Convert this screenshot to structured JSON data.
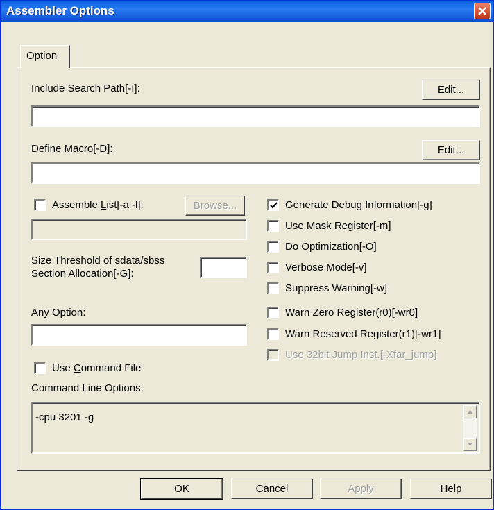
{
  "window": {
    "title": "Assembler Options"
  },
  "tabs": [
    {
      "label": "Option"
    }
  ],
  "include_path": {
    "label": "Include Search Path[-I]:",
    "edit_label": "Edit...",
    "value": ""
  },
  "define_macro": {
    "label_pre": "Define ",
    "label_u": "M",
    "label_post": "acro[-D]:",
    "edit_label": "Edit...",
    "value": ""
  },
  "assemble_list": {
    "label_pre": "Assemble ",
    "label_u": "L",
    "label_post": "ist[-a -l]:",
    "checked": false,
    "browse_label": "Browse...",
    "value": ""
  },
  "size_threshold": {
    "label_line1": "Size Threshold of sdata/sbss",
    "label_line2": "Section Allocation[-G]:",
    "value": ""
  },
  "any_option": {
    "label": "Any Option:",
    "value": ""
  },
  "use_command_file": {
    "label_pre": "Use ",
    "label_u": "C",
    "label_post": "ommand File",
    "checked": false
  },
  "command_line": {
    "label": "Command Line Options:",
    "value": "-cpu 3201 -g"
  },
  "options": [
    {
      "label": "Generate Debug Information[-g]",
      "checked": true,
      "enabled": true
    },
    {
      "label": "Use Mask Register[-m]",
      "checked": false,
      "enabled": true
    },
    {
      "label": "Do Optimization[-O]",
      "checked": false,
      "enabled": true
    },
    {
      "label": "Verbose Mode[-v]",
      "checked": false,
      "enabled": true
    },
    {
      "label": "Suppress Warning[-w]",
      "checked": false,
      "enabled": true
    },
    {
      "label": "Warn Zero Register(r0)[-wr0]",
      "checked": false,
      "enabled": true
    },
    {
      "label": "Warn Reserved Register(r1)[-wr1]",
      "checked": false,
      "enabled": true
    },
    {
      "label": "Use 32bit Jump Inst.[-Xfar_jump]",
      "checked": false,
      "enabled": false
    }
  ],
  "buttons": {
    "ok": "OK",
    "cancel": "Cancel",
    "apply": "Apply",
    "help": "Help"
  },
  "colors": {
    "titlebar": "#0A5FE0",
    "dialog_bg": "#ECE9D8",
    "close": "#D5512F"
  }
}
